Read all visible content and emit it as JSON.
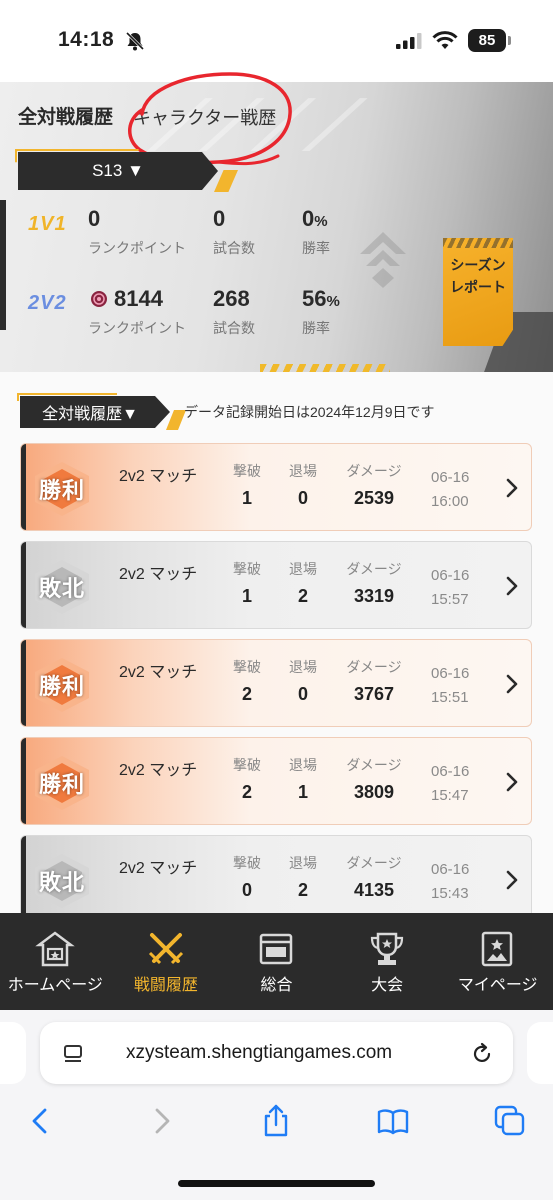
{
  "status_bar": {
    "time": "14:18",
    "battery": "85"
  },
  "header": {
    "tab_all": "全対戦履歴",
    "tab_character": "キャラクター戦歴",
    "season": "S13 ▼",
    "report_button": "シーズンレポート",
    "modes": [
      {
        "name": "1V1",
        "rank_points": "0",
        "rank_label": "ランクポイント",
        "matches": "0",
        "matches_label": "試合数",
        "win_rate": "0",
        "win_rate_unit": "%",
        "win_rate_label": "勝率"
      },
      {
        "name": "2V2",
        "rank_points": "8144",
        "rank_label": "ランクポイント",
        "matches": "268",
        "matches_label": "試合数",
        "win_rate": "56",
        "win_rate_unit": "%",
        "win_rate_label": "勝率"
      }
    ]
  },
  "list": {
    "filter": "全対戦履歴▼",
    "note": "データ記録開始日は2024年12月9日です",
    "col_kills": "撃破",
    "col_exits": "退場",
    "col_damage": "ダメージ",
    "matches": [
      {
        "result": "勝利",
        "outcome": "win",
        "mode": "2v2 マッチ",
        "kills": "1",
        "exits": "0",
        "damage": "2539",
        "date": "06-16",
        "time": "16:00"
      },
      {
        "result": "敗北",
        "outcome": "loss",
        "mode": "2v2 マッチ",
        "kills": "1",
        "exits": "2",
        "damage": "3319",
        "date": "06-16",
        "time": "15:57"
      },
      {
        "result": "勝利",
        "outcome": "win",
        "mode": "2v2 マッチ",
        "kills": "2",
        "exits": "0",
        "damage": "3767",
        "date": "06-16",
        "time": "15:51"
      },
      {
        "result": "勝利",
        "outcome": "win",
        "mode": "2v2 マッチ",
        "kills": "2",
        "exits": "1",
        "damage": "3809",
        "date": "06-16",
        "time": "15:47"
      },
      {
        "result": "敗北",
        "outcome": "loss",
        "mode": "2v2 マッチ",
        "kills": "0",
        "exits": "2",
        "damage": "4135",
        "date": "06-16",
        "time": "15:43"
      }
    ]
  },
  "bottom_nav": [
    {
      "label": "ホームページ",
      "icon": "home-icon",
      "active": false
    },
    {
      "label": "戦闘履歴",
      "icon": "crossed-swords-icon",
      "active": true
    },
    {
      "label": "総合",
      "icon": "summary-icon",
      "active": false
    },
    {
      "label": "大会",
      "icon": "trophy-icon",
      "active": false
    },
    {
      "label": "マイページ",
      "icon": "profile-card-icon",
      "active": false
    }
  ],
  "browser": {
    "url": "xzysteam.shengtiangames.com"
  },
  "colors": {
    "accent": "#f2b52d",
    "win": "#f8a87c",
    "loss": "#d2d2d2",
    "dark": "#2b2b2b",
    "mode_2v2": "#6b8ee0"
  }
}
